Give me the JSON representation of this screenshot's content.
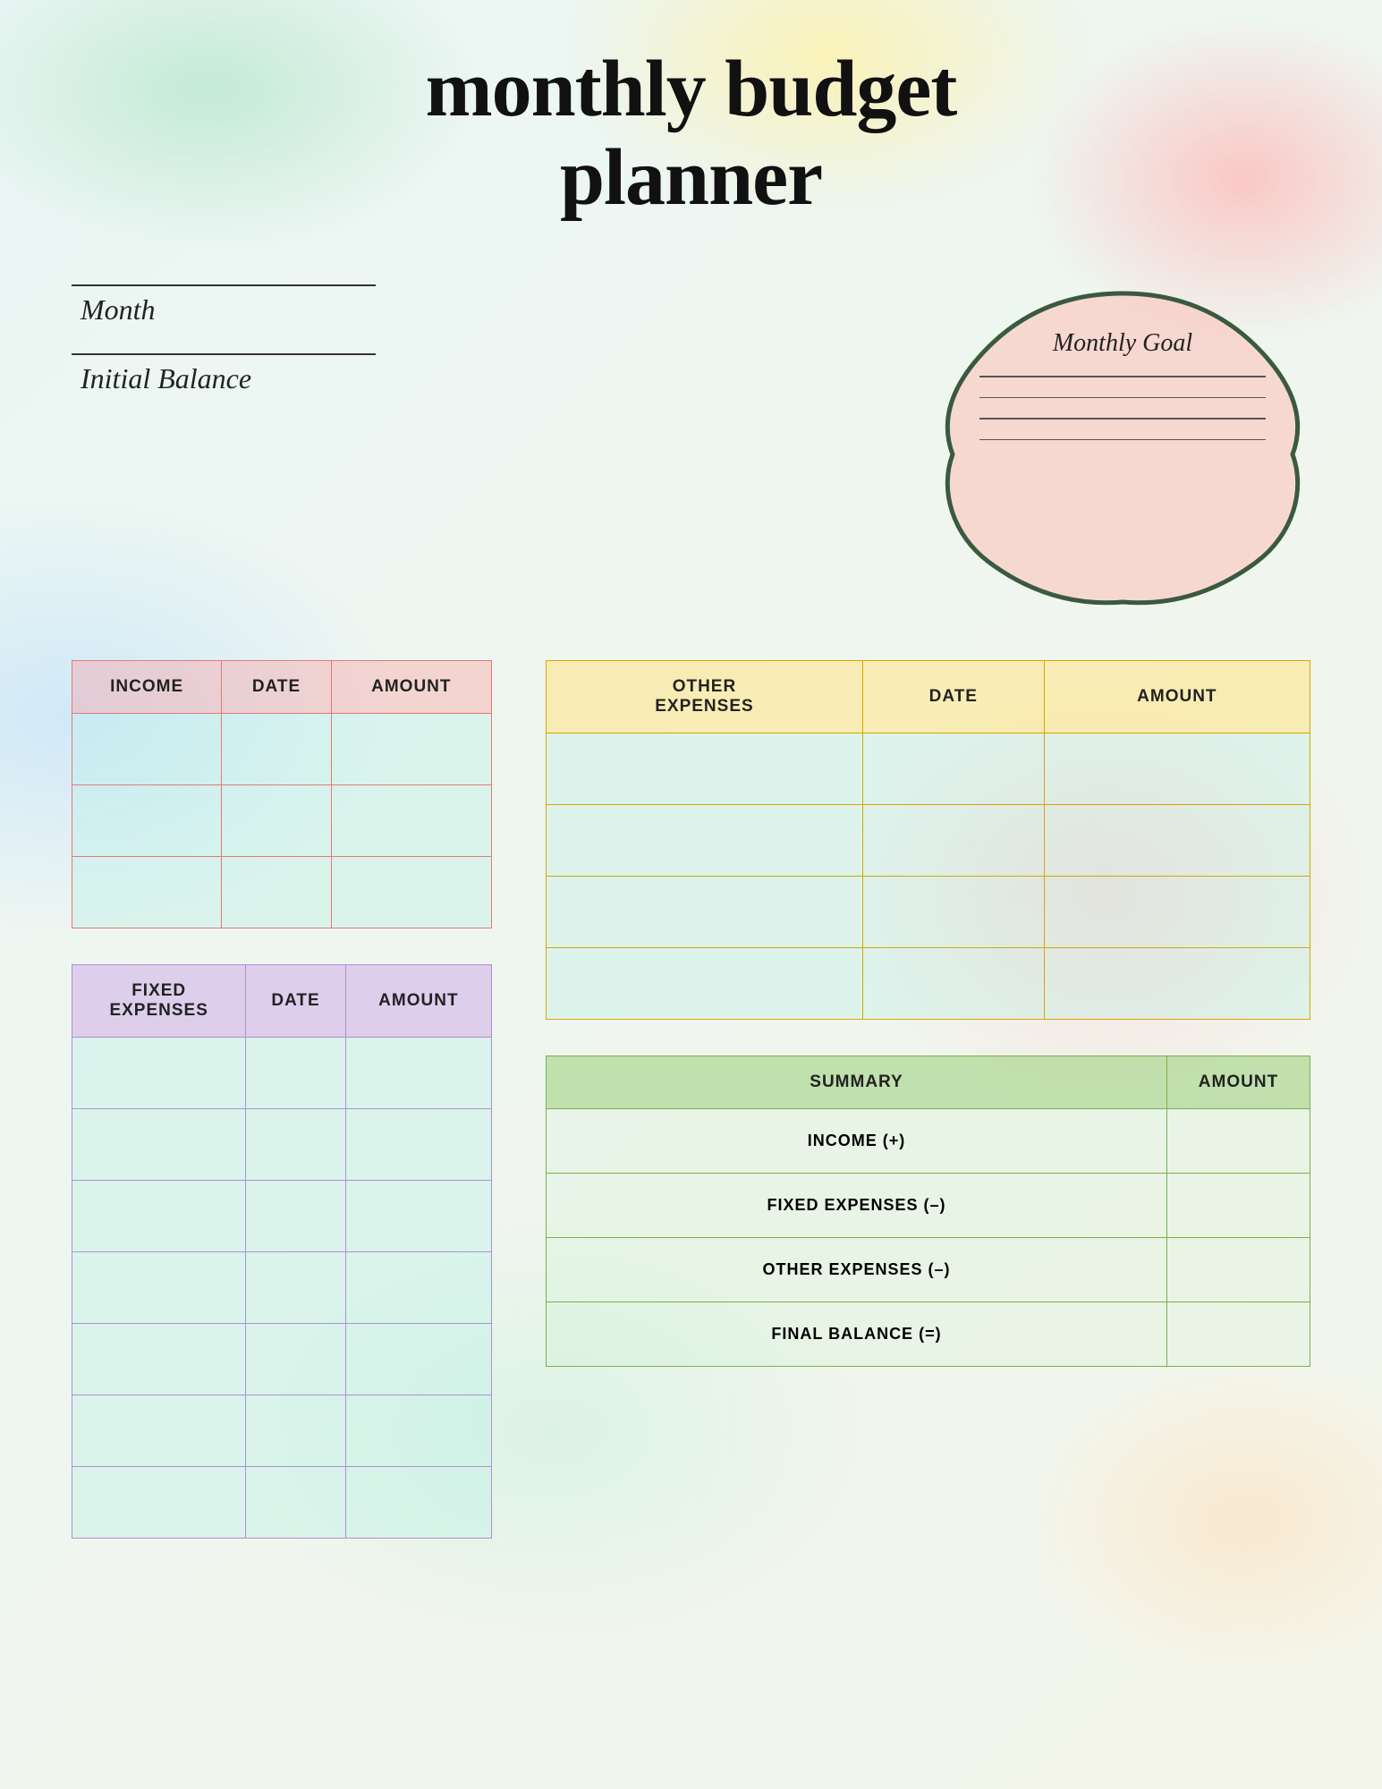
{
  "title": {
    "line1": "monthly budget",
    "line2": "planner"
  },
  "fields": {
    "month_label": "Month",
    "balance_label": "Initial Balance"
  },
  "goal_box": {
    "title": "Monthly Goal",
    "lines": [
      "",
      "",
      "",
      ""
    ]
  },
  "income_table": {
    "headers": [
      "INCOME",
      "DATE",
      "AMOUNT"
    ],
    "rows": 3
  },
  "fixed_table": {
    "headers": [
      "FIXED\nEXPENSES",
      "DATE",
      "AMOUNT"
    ],
    "rows": 7
  },
  "other_table": {
    "headers": [
      "OTHER\nEXPENSES",
      "DATE",
      "AMOUNT"
    ],
    "rows": 4
  },
  "summary_table": {
    "headers": [
      "SUMMARY",
      "AMOUNT"
    ],
    "rows": [
      "INCOME (+)",
      "FIXED EXPENSES (–)",
      "OTHER EXPENSES (–)",
      "FINAL BALANCE (=)"
    ]
  },
  "colors": {
    "income_header_bg": "rgba(255,150,150,0.35)",
    "income_border": "#e87878",
    "fixed_header_bg": "rgba(200,160,230,0.45)",
    "fixed_border": "#b090d0",
    "other_header_bg": "rgba(255,230,140,0.6)",
    "other_border": "#d4a800",
    "summary_header_bg": "rgba(160,210,130,0.6)",
    "summary_border": "#7ab050"
  }
}
